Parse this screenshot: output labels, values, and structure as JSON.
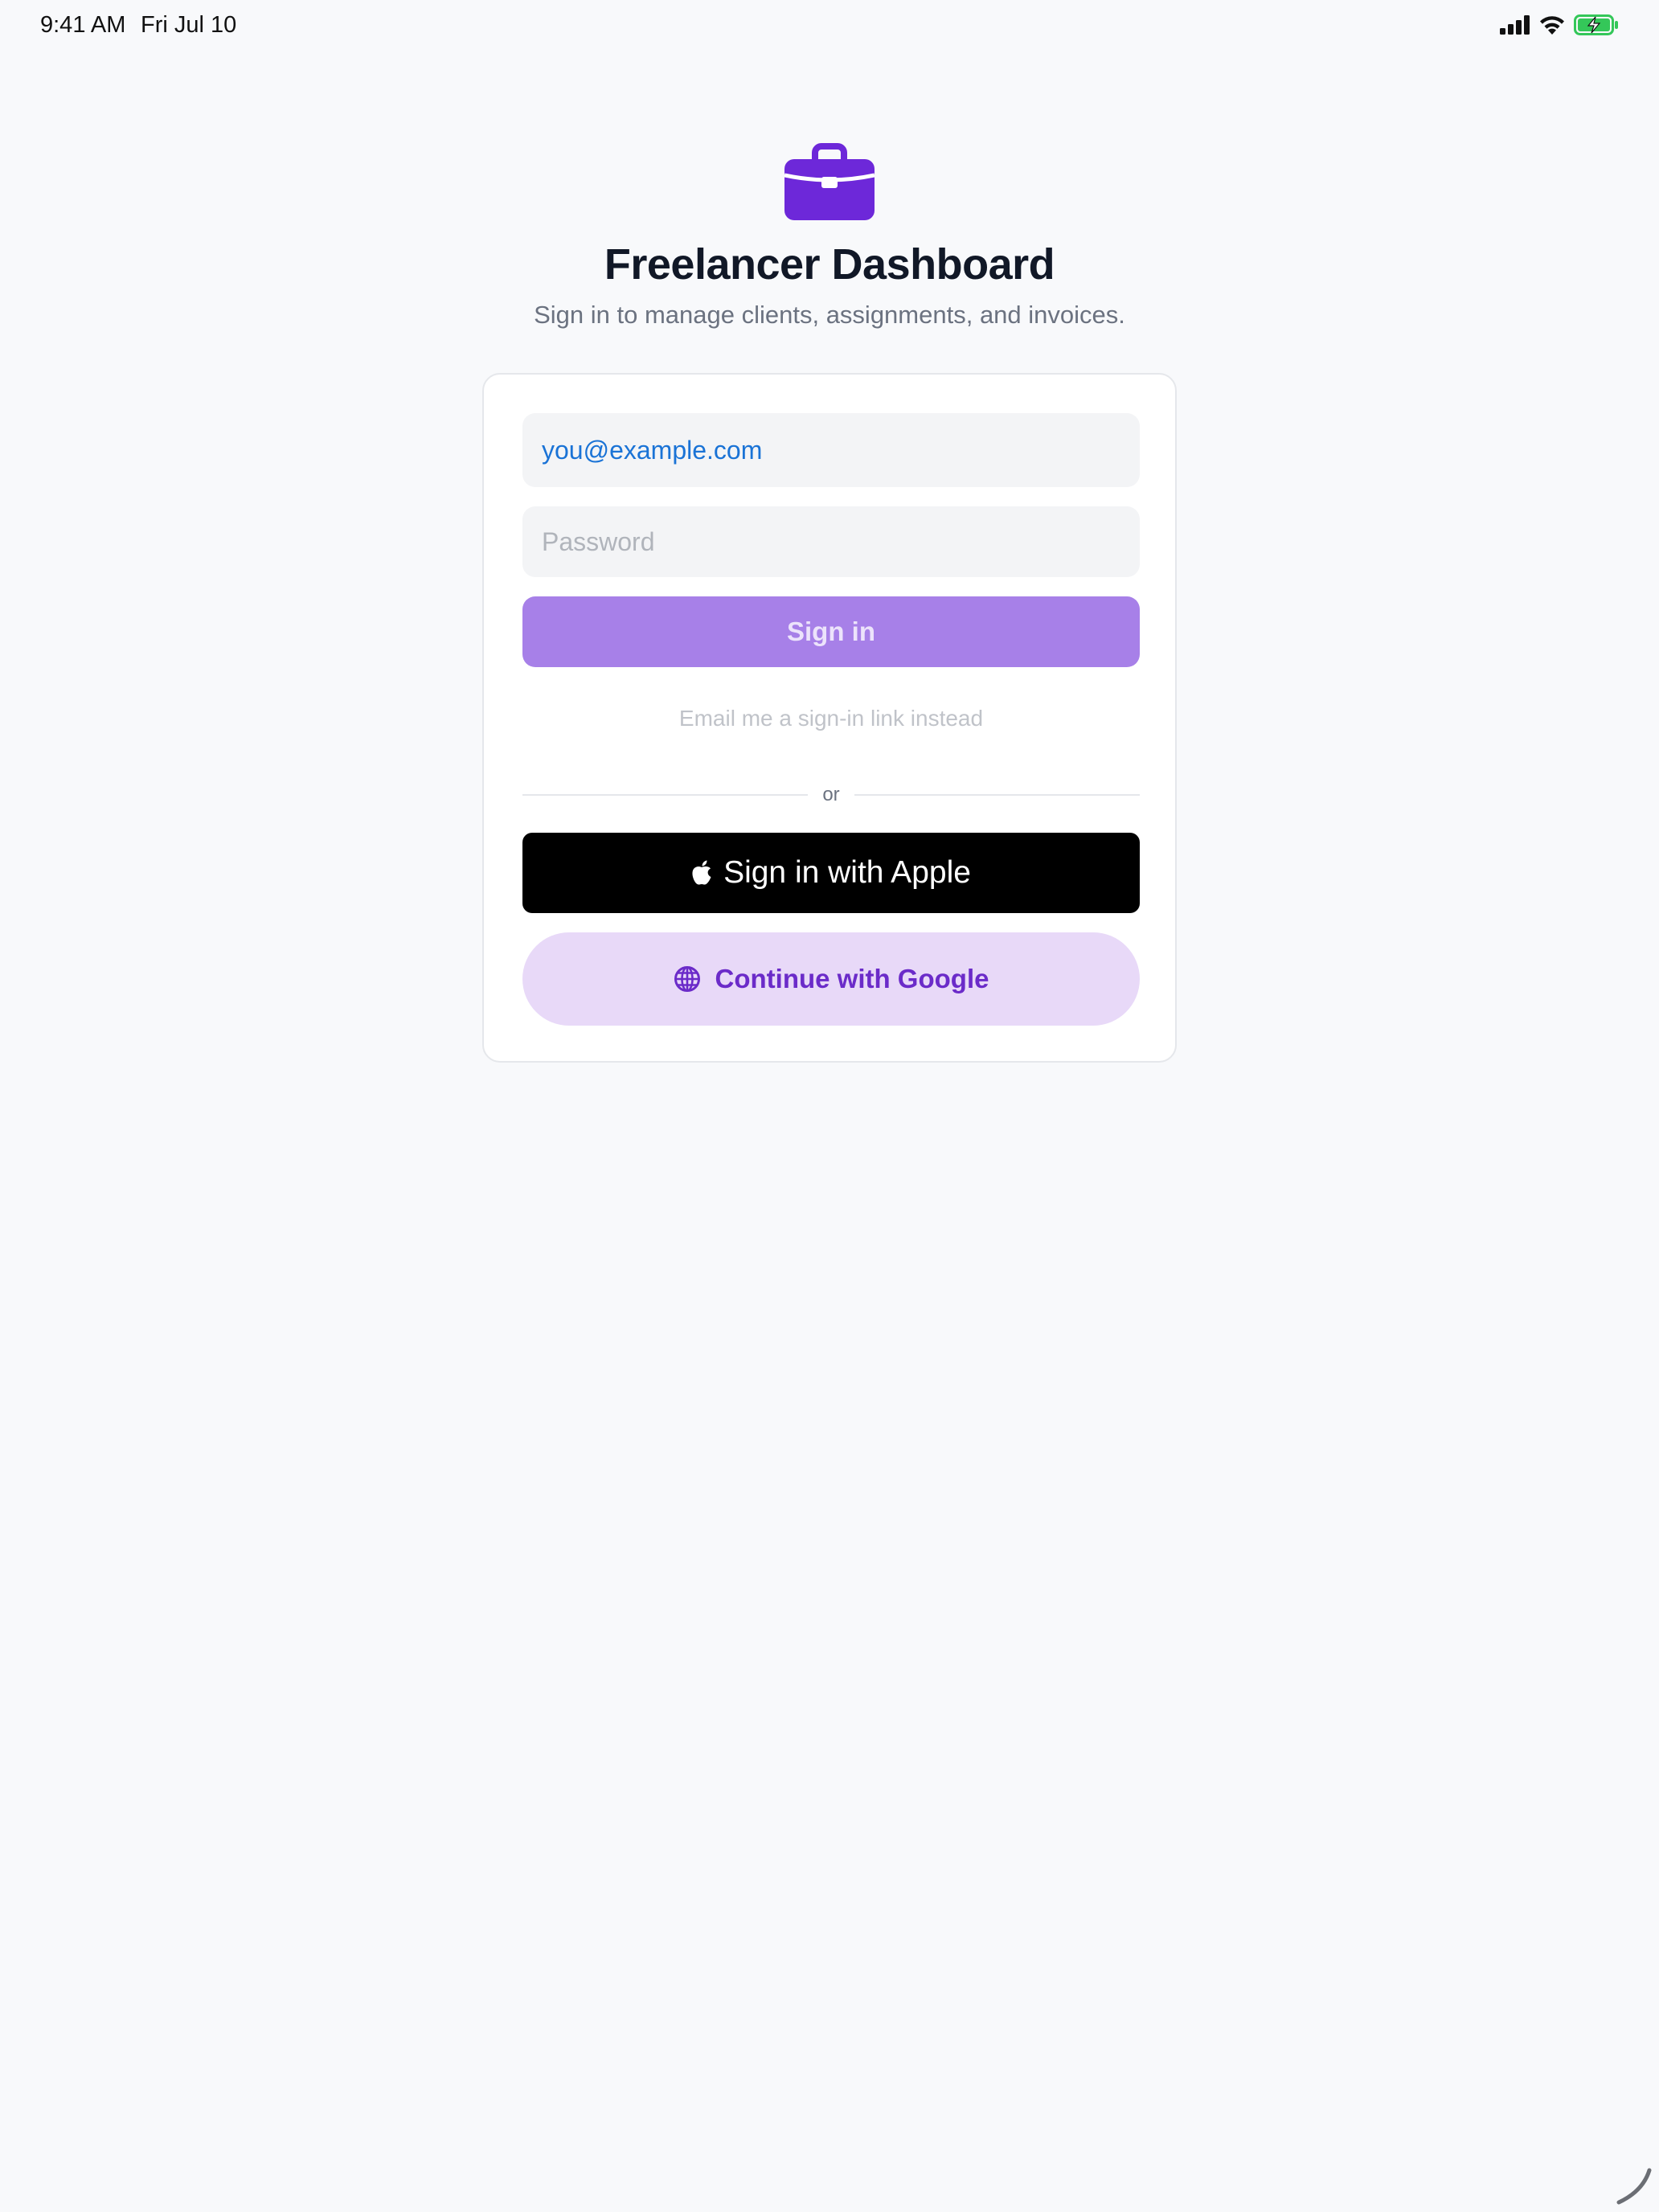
{
  "status_bar": {
    "time": "9:41 AM",
    "date": "Fri Jul 10",
    "icons": [
      "cellular-signal-icon",
      "wifi-icon",
      "battery-charging-icon"
    ]
  },
  "header": {
    "logo_icon": "briefcase-icon",
    "title": "Freelancer Dashboard",
    "subtitle": "Sign in to manage clients, assignments, and invoices."
  },
  "form": {
    "email": {
      "value": "you@example.com",
      "placeholder": "you@example.com"
    },
    "password": {
      "value": "",
      "placeholder": "Password"
    },
    "signin_label": "Sign in",
    "magic_link_label": "Email me a sign-in link instead",
    "divider_label": "or",
    "apple_label": "Sign in with Apple",
    "apple_icon": "apple-logo-icon",
    "google_label": "Continue with Google",
    "google_icon": "globe-icon"
  },
  "colors": {
    "accent": "#6d28d9",
    "signin_button": "#a780e8",
    "google_button_bg": "#e8d9f8",
    "email_text": "#1a73d6",
    "page_background": "#f8f9fb"
  }
}
